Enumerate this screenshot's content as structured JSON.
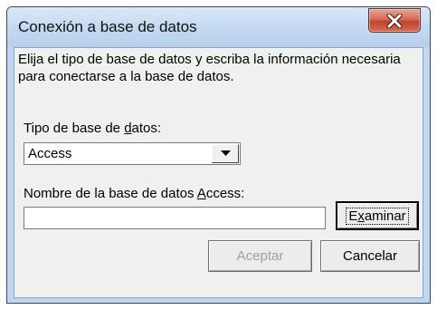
{
  "window": {
    "title": "Conexión a base de datos",
    "close_glyph": "X"
  },
  "description": "Elija el tipo de base de datos y escriba la información necesaria para conectarse a la base de datos.",
  "db_type": {
    "label_before": "Tipo de base de ",
    "label_access_key": "d",
    "label_after": "atos:",
    "selected": "Access"
  },
  "db_name": {
    "label_before": "Nombre de la base de datos ",
    "label_access_key": "A",
    "label_after": "ccess:",
    "value": ""
  },
  "buttons": {
    "browse_before": "E",
    "browse_access_key": "x",
    "browse_after": "aminar",
    "ok": "Aceptar",
    "cancel": "Cancelar"
  },
  "states": {
    "ok_enabled": false
  },
  "icons": {
    "close": "close-icon",
    "dropdown": "chevron-down-icon"
  },
  "colors": {
    "title_bar": "#c6dbf2",
    "close_button": "#c2432c",
    "dialog_face": "#f0f0f0",
    "disabled_text": "#a0a0a0"
  }
}
